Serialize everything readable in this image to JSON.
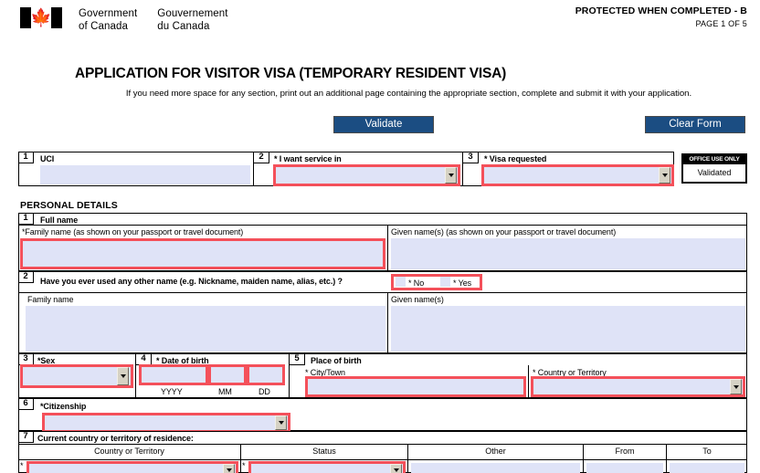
{
  "header": {
    "gov_en_line1": "Government",
    "gov_en_line2": "of Canada",
    "gov_fr_line1": "Gouvernement",
    "gov_fr_line2": "du Canada",
    "flag_icon": "canada-flag-icon",
    "maple_leaf": "🍁",
    "protected_label": "PROTECTED WHEN COMPLETED - B",
    "page_label": "PAGE 1 OF 5"
  },
  "title": "APPLICATION FOR VISITOR VISA (TEMPORARY RESIDENT VISA)",
  "subtitle": "If you need more space for any section, print out an additional page containing the appropriate section, complete and submit it with your application.",
  "toolbar": {
    "validate_label": "Validate",
    "clear_label": "Clear Form"
  },
  "colors": {
    "button_blue": "#1b4d82",
    "required_red": "#f4505a",
    "field_fill": "#dfe3f7",
    "dropdown_grey": "#d6d2c4"
  },
  "top_row": {
    "uci": {
      "num": "1",
      "label": "UCI",
      "value": ""
    },
    "service_in": {
      "num": "2",
      "label": "* I want service in",
      "value": ""
    },
    "visa_requested": {
      "num": "3",
      "label": "* Visa requested",
      "value": ""
    },
    "office_use": {
      "header": "OFFICE USE ONLY",
      "status": "Validated"
    }
  },
  "personal_details": {
    "heading": "PERSONAL DETAILS",
    "full_name": {
      "num": "1",
      "label": "Full name",
      "family_label": "*Family name  (as shown on your passport or travel document)",
      "family_value": "",
      "given_label": "Given name(s)  (as shown on your passport or travel document)",
      "given_value": ""
    },
    "other_name": {
      "num": "2",
      "question": "Have you ever used any other name (e.g. Nickname, maiden name, alias, etc.) ?",
      "no_label": "* No",
      "yes_label": "* Yes",
      "family_label": "Family name",
      "family_value": "",
      "given_label": "Given name(s)",
      "given_value": ""
    },
    "sex": {
      "num": "3",
      "label": "*Sex",
      "value": ""
    },
    "dob": {
      "num": "4",
      "label": "* Date of birth",
      "yyyy_label": "YYYY",
      "yyyy_value": "",
      "mm_label": "MM",
      "mm_value": "",
      "dd_label": "DD",
      "dd_value": ""
    },
    "place_of_birth": {
      "num": "5",
      "label": "Place of birth",
      "city_label": "* City/Town",
      "city_value": "",
      "country_label": "* Country or Territory",
      "country_value": ""
    },
    "citizenship": {
      "num": "6",
      "label": "*Citizenship",
      "value": ""
    },
    "residence": {
      "num": "7",
      "label": "Current country or territory of residence:",
      "columns": [
        "Country or Territory",
        "Status",
        "Other",
        "From",
        "To"
      ],
      "rows": [
        {
          "star": "*",
          "country": "",
          "status_star": "*",
          "status": "",
          "other": "",
          "from": "",
          "to": ""
        }
      ]
    }
  }
}
